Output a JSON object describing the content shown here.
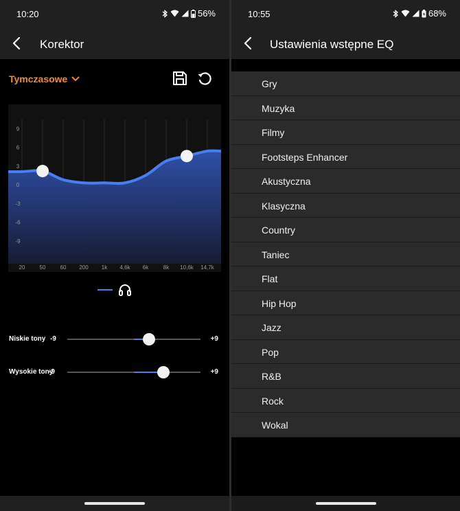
{
  "left": {
    "status": {
      "time": "10:20",
      "battery": "56%"
    },
    "title": "Korektor",
    "preset": "Tymczasowe",
    "chart_data": {
      "type": "area",
      "categories": [
        "20",
        "50",
        "60",
        "200",
        "1k",
        "4,6k",
        "6k",
        "8k",
        "10,6k",
        "14,7k"
      ],
      "values": [
        2.1,
        2.2,
        0.8,
        0.3,
        0.3,
        0.3,
        1.5,
        3.8,
        4.6,
        5.4
      ],
      "ylim": [
        -12,
        12
      ],
      "yticks": [
        "9",
        "6",
        "3",
        "0",
        "-3",
        "-6",
        "-9"
      ],
      "control_points": [
        {
          "x": "50",
          "y": 2.2
        },
        {
          "x": "10,6k",
          "y": 4.6
        }
      ],
      "color": "#4a7ef0"
    },
    "sliders": [
      {
        "label": "Niskie tony",
        "min": "-9",
        "max": "+9",
        "value": 2
      },
      {
        "label": "Wysokie tony",
        "min": "-9",
        "max": "+9",
        "value": 4
      }
    ]
  },
  "right": {
    "status": {
      "time": "10:55",
      "battery": "68%"
    },
    "title": "Ustawienia wstępne EQ",
    "presets": [
      "Gry",
      "Muzyka",
      "Filmy",
      "Footsteps Enhancer",
      "Akustyczna",
      "Klasyczna",
      "Country",
      "Taniec",
      "Flat",
      "Hip Hop",
      "Jazz",
      "Pop",
      "R&B",
      "Rock",
      "Wokal"
    ]
  }
}
